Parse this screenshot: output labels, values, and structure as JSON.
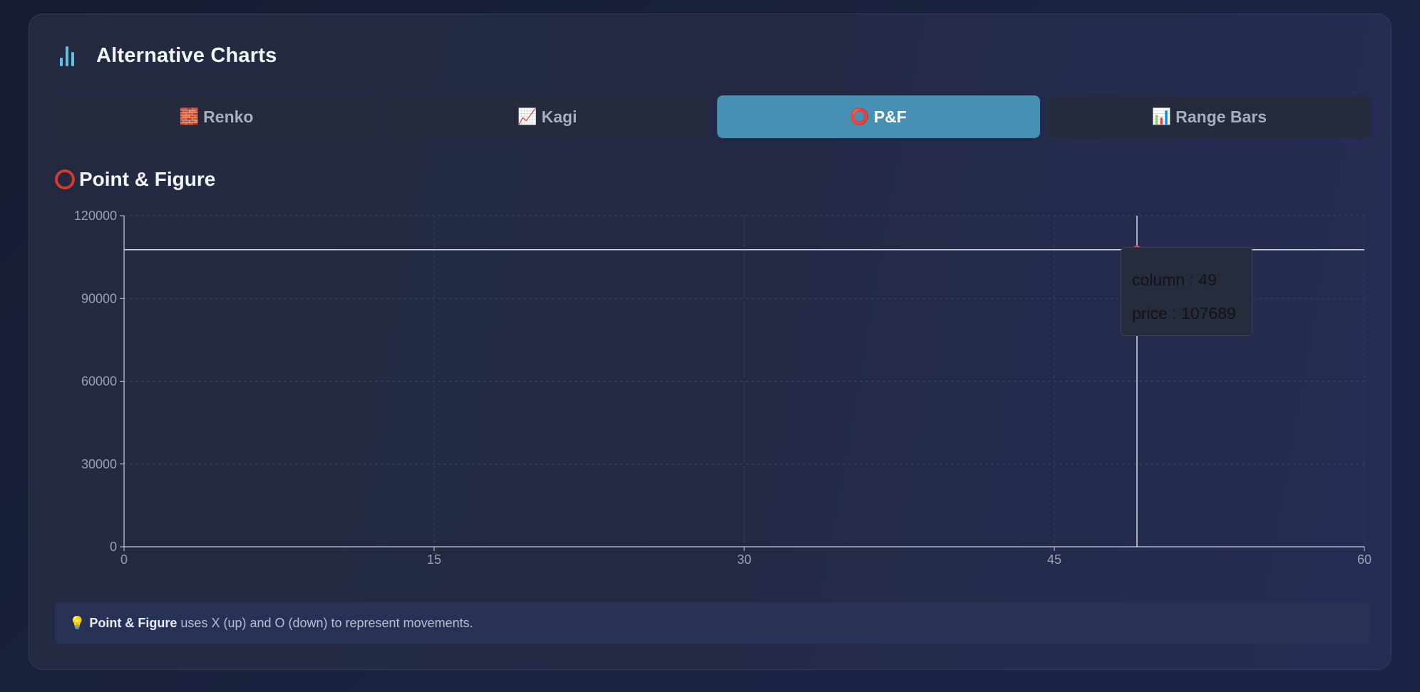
{
  "header": {
    "title": "Alternative Charts",
    "icon": "bar-chart-icon"
  },
  "tabs": [
    {
      "icon": "🧱",
      "label": "Renko",
      "active": false
    },
    {
      "icon": "📈",
      "label": "Kagi",
      "active": false
    },
    {
      "icon": "⭕",
      "label": "P&F",
      "active": true
    },
    {
      "icon": "📊",
      "label": "Range Bars",
      "active": false
    }
  ],
  "section": {
    "title": "Point & Figure",
    "icon": "red-ring-icon"
  },
  "chart_data": {
    "type": "line",
    "title": "",
    "xlabel": "",
    "ylabel": "",
    "xlim": [
      0,
      60
    ],
    "ylim": [
      0,
      120000
    ],
    "x_ticks": [
      "0",
      "15",
      "30",
      "45",
      "60"
    ],
    "y_ticks": [
      "0",
      "30000",
      "60000",
      "90000",
      "120000"
    ],
    "grid": true,
    "series": [],
    "crosshair": {
      "column": 49,
      "price": 107689
    },
    "colors": {
      "crosshair": "#d6d9e0",
      "marker": "#e04b45",
      "grid": "#3d4560",
      "axis": "#c9ccd4"
    }
  },
  "tooltip": {
    "column_label": "column",
    "column_value": "49",
    "price_label": "price",
    "price_value": "107689"
  },
  "tip": {
    "icon": "💡",
    "bold": "Point & Figure",
    "text": "uses X (up) and O (down) to represent movements."
  }
}
